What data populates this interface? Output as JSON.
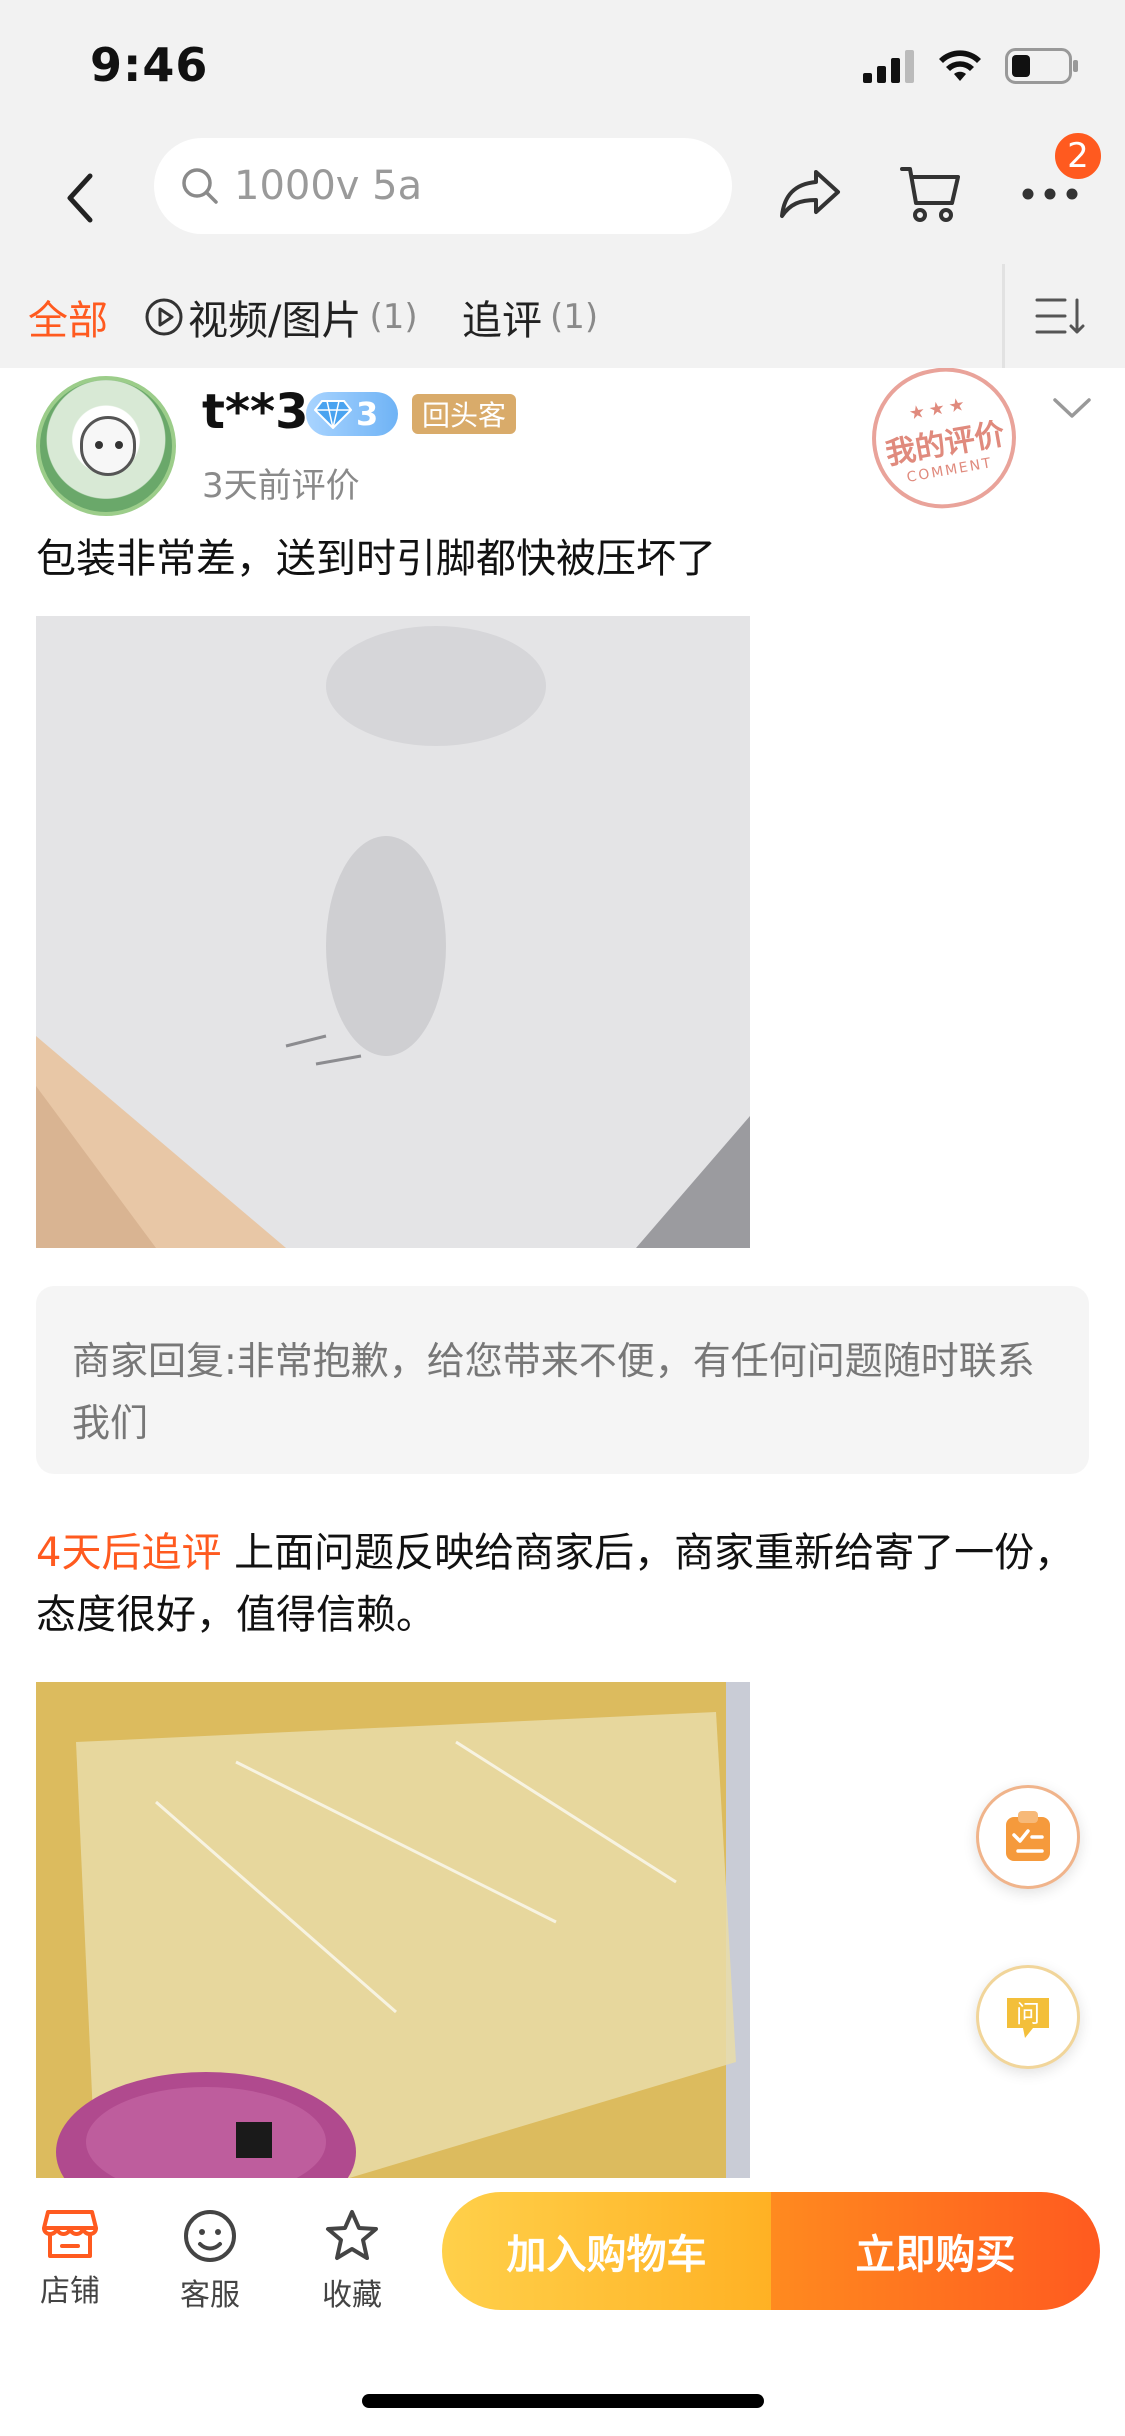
{
  "status_bar": {
    "time": "9:46"
  },
  "nav": {
    "search_text": "1000v 5a",
    "cart_badge": "2"
  },
  "tabs": [
    {
      "label": "全部",
      "count": ""
    },
    {
      "label": "视频/图片",
      "count": "(1)"
    },
    {
      "label": "追评",
      "count": "(1)"
    }
  ],
  "review": {
    "username": "t**3",
    "vip_level": "3",
    "returning_badge": "回头客",
    "time": "3天前评价",
    "stamp_text": "我的评价",
    "stamp_sub": "COMMENT",
    "text": "包装非常差，送到时引脚都快被压坏了",
    "merchant_reply": "商家回复:非常抱歉，给您带来不便，有任何问题随时联系我们",
    "followup_tag": "4天后追评",
    "followup_text": " 上面问题反映给商家后，商家重新给寄了一份，态度很好，值得信赖。"
  },
  "floating": {
    "ask_label": "问"
  },
  "bottom_bar": {
    "store_label": "店铺",
    "service_label": "客服",
    "favorite_label": "收藏",
    "add_to_cart_label": "加入购物车",
    "buy_now_label": "立即购买"
  },
  "colors": {
    "accent": "#ff5a1f",
    "cta_yellow": "#ffc233",
    "cta_orange": "#ff6a1f"
  }
}
